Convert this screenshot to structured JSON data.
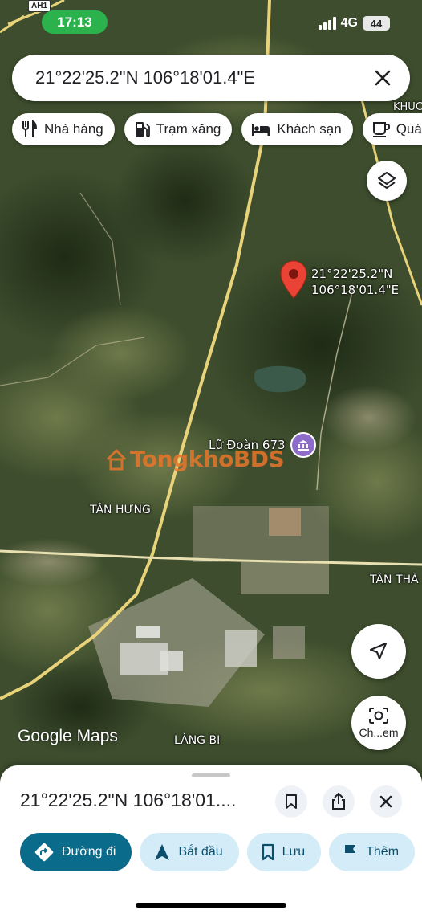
{
  "status_bar": {
    "time": "17:13",
    "network": "4G",
    "battery": "44",
    "route_shield": "AH1"
  },
  "search": {
    "query": "21°22'25.2\"N 106°18'01.4\"E"
  },
  "chips": [
    {
      "label": "Nhà hàng",
      "icon": "restaurant-icon"
    },
    {
      "label": "Trạm xăng",
      "icon": "gas-station-icon"
    },
    {
      "label": "Khách sạn",
      "icon": "hotel-icon"
    },
    {
      "label": "Quán",
      "icon": "cafe-icon"
    }
  ],
  "map": {
    "pin_label_line1": "21°22'25.2\"N",
    "pin_label_line2": "106°18'01.4\"E",
    "poi_label": "Lữ Đoàn 673",
    "watermark": "TongkhoBDS",
    "place_labels": {
      "tan_hung": "TÂN HƯNG",
      "tan_thanh": "TÂN THÀ",
      "lang_bi": "LÀNG BI",
      "khuc": "KHUC"
    },
    "pin_color": "#ea4335"
  },
  "lens": {
    "label": "Ch...em"
  },
  "branding": {
    "google": "Google",
    "maps": "Maps"
  },
  "sheet": {
    "title": "21°22'25.2\"N 106°18'01....",
    "actions": [
      {
        "label": "Đường đi",
        "icon": "directions-icon"
      },
      {
        "label": "Bắt đầu",
        "icon": "navigation-icon"
      },
      {
        "label": "Lưu",
        "icon": "bookmark-icon"
      },
      {
        "label": "Thêm",
        "icon": "flag-icon"
      }
    ]
  },
  "colors": {
    "accent": "#0b6b8a",
    "chip_bg": "#d4ecf7",
    "status_green": "#2bb24c"
  }
}
